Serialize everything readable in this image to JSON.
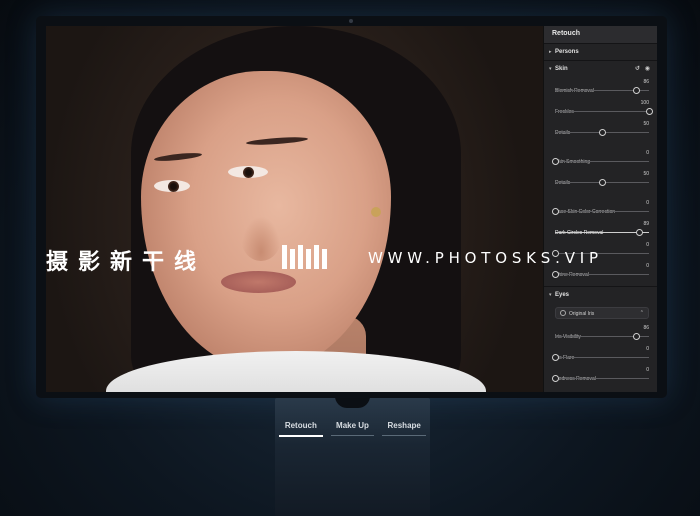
{
  "panel": {
    "title": "Retouch",
    "sections": {
      "persons": "Persons",
      "skin": "Skin",
      "eyes": "Eyes"
    },
    "sliders": [
      {
        "label": "Blemish Removal",
        "value": "86",
        "level": 0.86
      },
      {
        "label": "Freckles",
        "value": "100",
        "level": 1.0
      },
      {
        "label": "Details",
        "value": "50",
        "level": 0.5
      },
      {
        "label": "Skin Smoothing",
        "value": "0",
        "level": 0.0
      },
      {
        "label": "Details",
        "value": "50",
        "level": 0.5
      },
      {
        "label": "Face Skin Color Correction",
        "value": "0",
        "level": 0.0
      },
      {
        "label": "Dark Circles Removal",
        "value": "89",
        "level": 0.89,
        "active": true
      },
      {
        "label": "",
        "value": "0",
        "level": 0.0
      },
      {
        "label": "Shine Removal",
        "value": "0",
        "level": 0.0
      },
      {
        "label": "Iris Visibility",
        "value": "86",
        "level": 0.86
      },
      {
        "label": "Iris Flare",
        "value": "0",
        "level": 0.0
      },
      {
        "label": "Redness Removal",
        "value": "0",
        "level": 0.0
      }
    ],
    "iris_select": "Original Iris"
  },
  "watermark": {
    "cn": "摄影新干线",
    "en": "WWW.PHOTOSKS.VIP"
  },
  "tabs": [
    {
      "label": "Retouch",
      "active": true
    },
    {
      "label": "Make Up",
      "active": false
    },
    {
      "label": "Reshape",
      "active": false
    }
  ],
  "icons": {
    "reset": "reset-icon",
    "visibility": "eye-icon"
  }
}
